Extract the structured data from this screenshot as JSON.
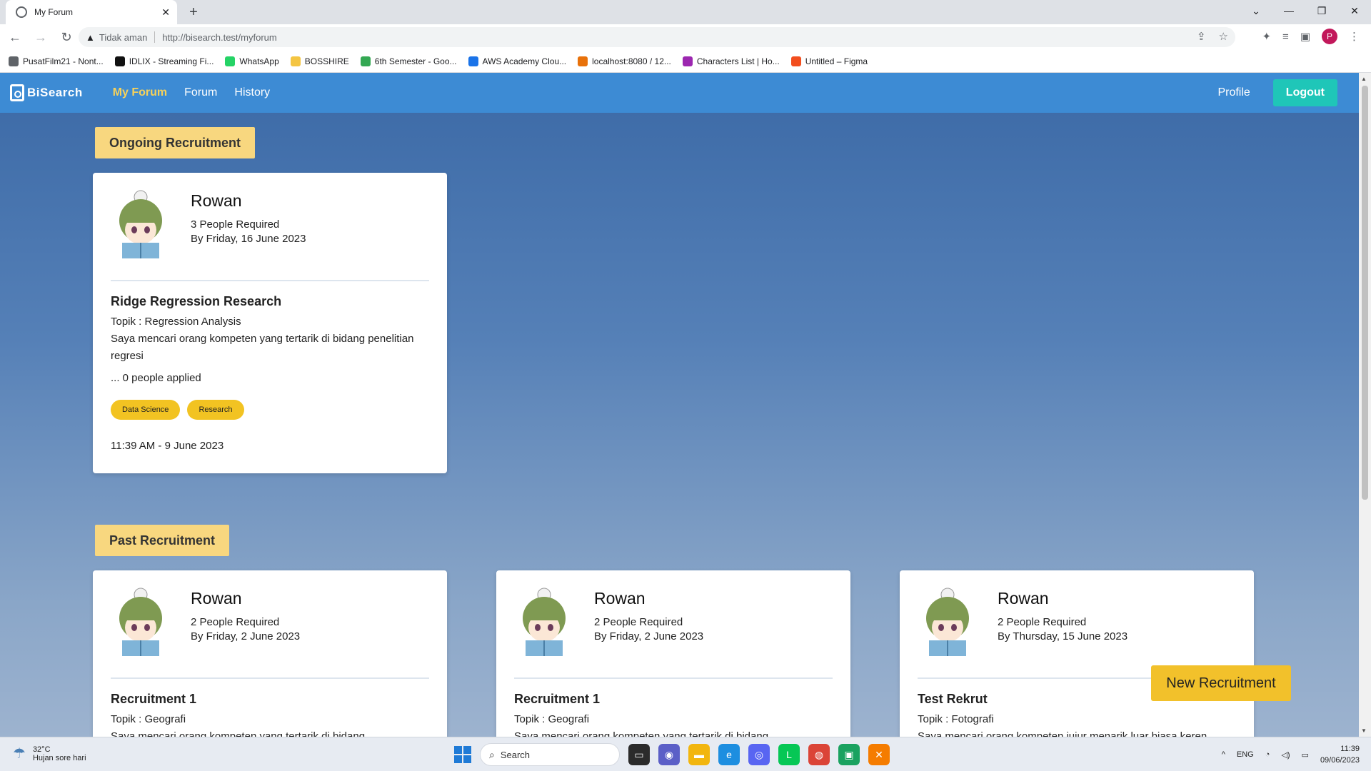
{
  "browser": {
    "tab_title": "My Forum",
    "security_label": "Tidak aman",
    "url": "http://bisearch.test/myforum",
    "bookmarks": [
      {
        "label": "PusatFilm21 - Nont...",
        "color": "#5f6368"
      },
      {
        "label": "IDLIX - Streaming Fi...",
        "color": "#111111"
      },
      {
        "label": "WhatsApp",
        "color": "#25d366"
      },
      {
        "label": "BOSSHIRE",
        "color": "#f4c542"
      },
      {
        "label": "6th Semester - Goo...",
        "color": "#34a853"
      },
      {
        "label": "AWS Academy Clou...",
        "color": "#1a73e8"
      },
      {
        "label": "localhost:8080 / 12...",
        "color": "#e8710a"
      },
      {
        "label": "Characters List | Ho...",
        "color": "#9c27b0"
      },
      {
        "label": "Untitled – Figma",
        "color": "#f24e1e"
      }
    ],
    "profile_initial": "P"
  },
  "app": {
    "logo": "BiSearch",
    "nav": {
      "myforum": "My Forum",
      "forum": "Forum",
      "history": "History"
    },
    "profile": "Profile",
    "logout": "Logout"
  },
  "ongoing": {
    "label": "Ongoing Recruitment",
    "cards": [
      {
        "user": "Rowan",
        "required": "3 People Required",
        "due": "By Friday, 16 June 2023",
        "title": "Ridge Regression Research",
        "topic": "Topik : Regression Analysis",
        "desc": "Saya mencari orang kompeten yang tertarik di bidang penelitian regresi",
        "applied": "... 0 people applied",
        "tags": [
          "Data Science",
          "Research"
        ],
        "time": "11:39 AM - 9 June 2023"
      }
    ]
  },
  "past": {
    "label": "Past Recruitment",
    "cards": [
      {
        "user": "Rowan",
        "required": "2 People Required",
        "due": "By Friday, 2 June 2023",
        "title": "Recruitment 1",
        "topic": "Topik : Geografi",
        "desc": "Saya mencari orang kompeten yang tertarik di bidang"
      },
      {
        "user": "Rowan",
        "required": "2 People Required",
        "due": "By Friday, 2 June 2023",
        "title": "Recruitment 1",
        "topic": "Topik : Geografi",
        "desc": "Saya mencari orang kompeten yang tertarik di bidang"
      },
      {
        "user": "Rowan",
        "required": "2 People Required",
        "due": "By Thursday, 15 June 2023",
        "title": "Test Rekrut",
        "topic": "Topik : Fotografi",
        "desc": "Saya mencari orang kompeten jujur menarik luar biasa keren"
      }
    ]
  },
  "new_recruitment": "New Recruitment",
  "taskbar": {
    "temp": "32°C",
    "weather": "Hujan sore hari",
    "search": "Search",
    "lang": "ENG",
    "time": "11:39",
    "date": "09/06/2023"
  }
}
